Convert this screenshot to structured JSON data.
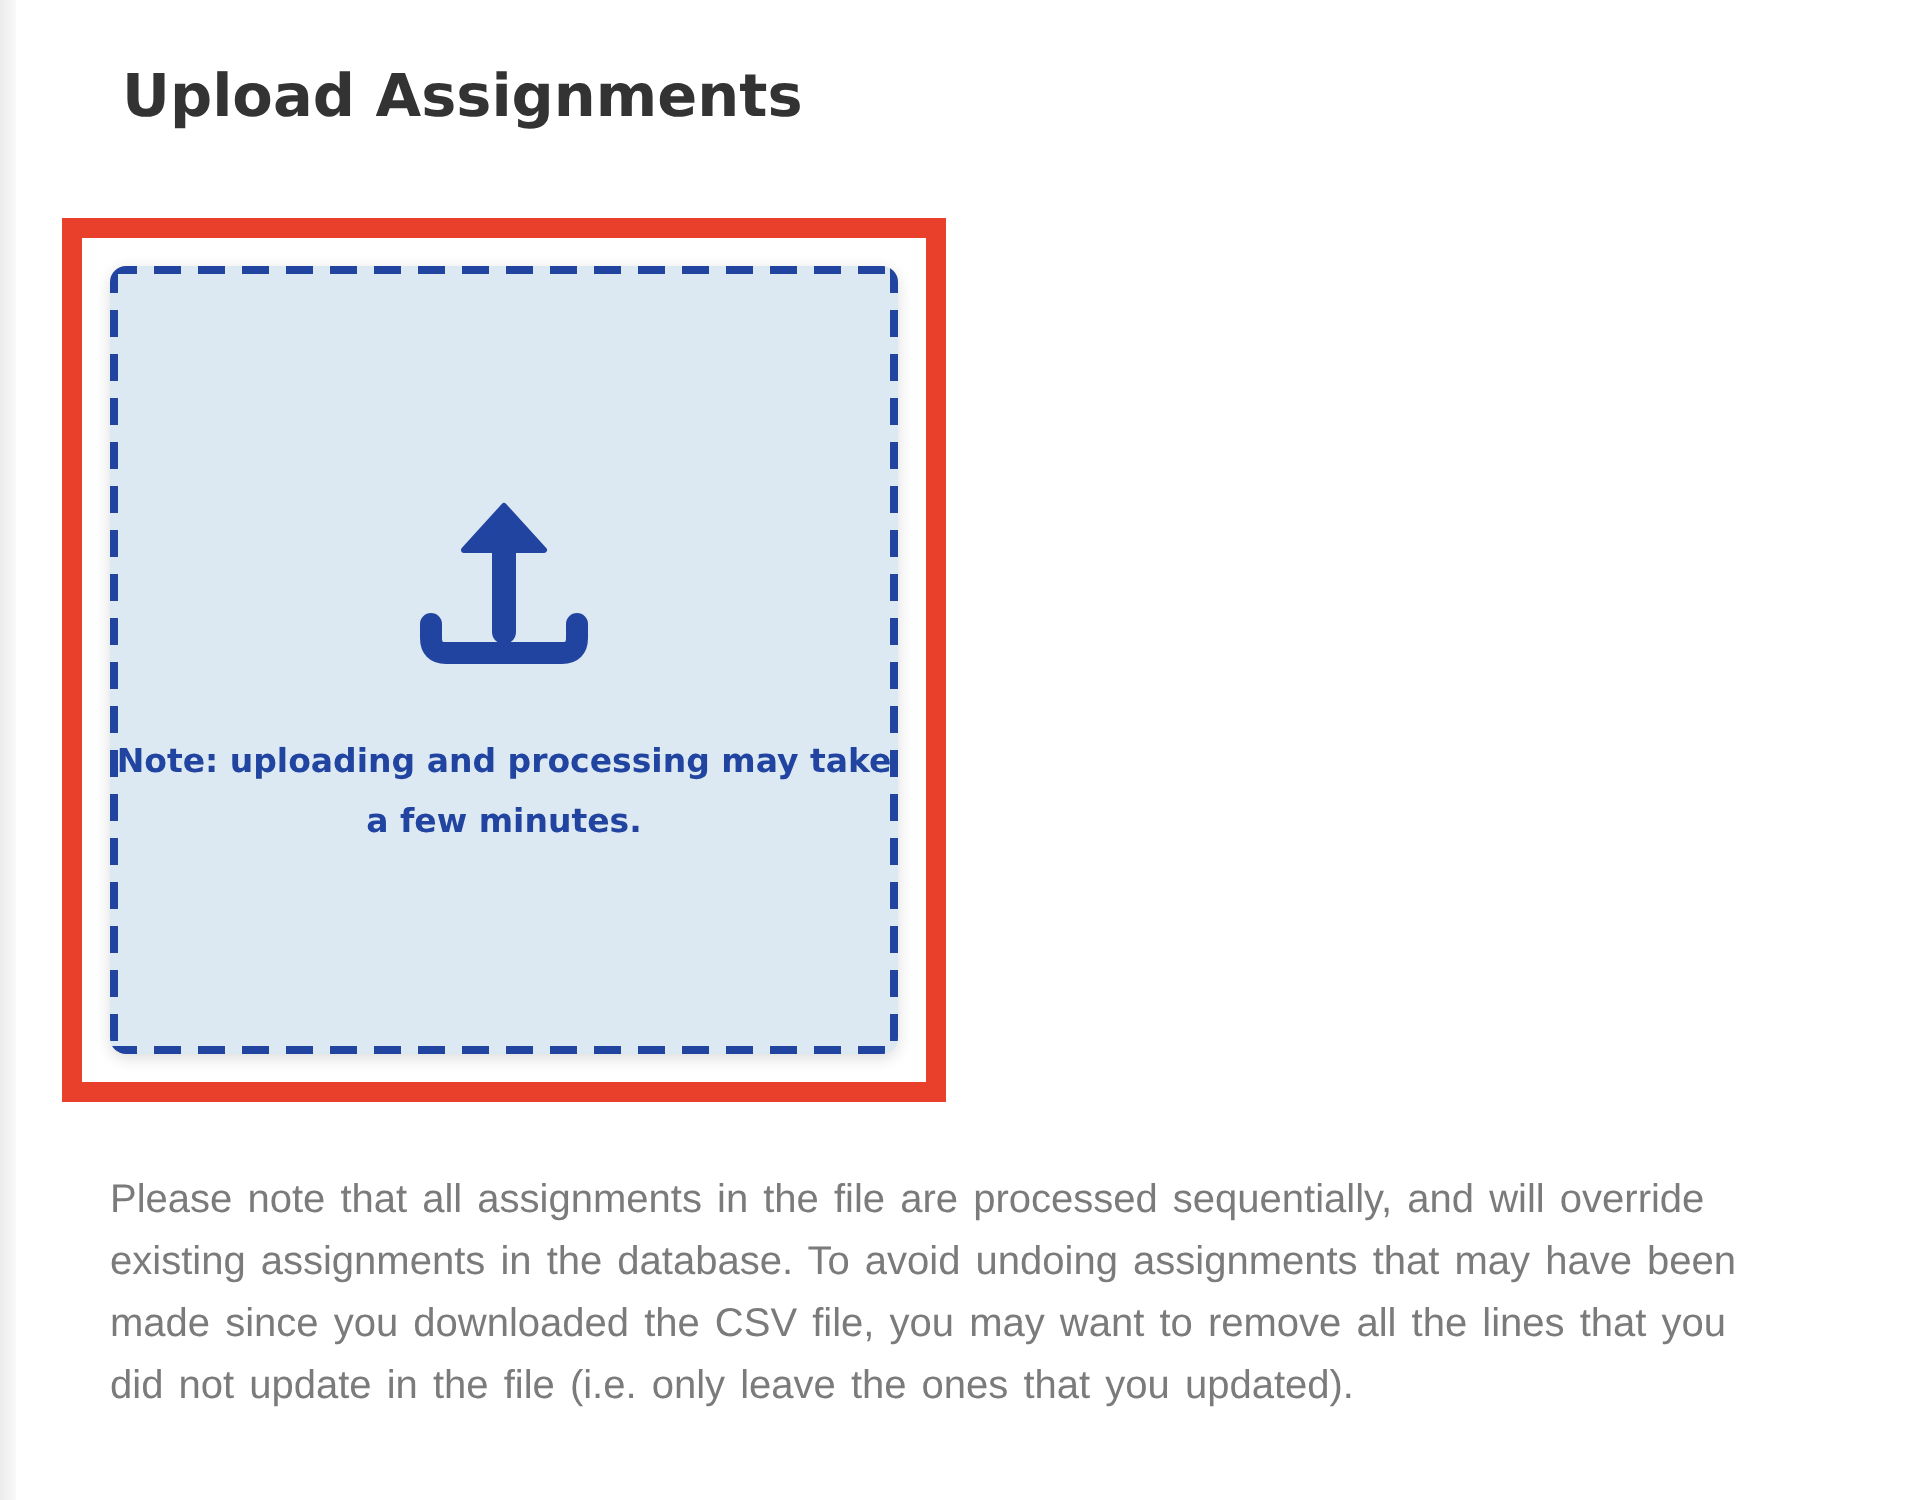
{
  "page": {
    "title": "Upload Assignments"
  },
  "dropzone": {
    "highlighted": true,
    "note": "Note: uploading and processing may take a few minutes."
  },
  "info_text": "Please note that all assignments in the file are processed sequentially, and will override existing assignments in the database. To avoid undoing assignments that may have been made since you downloaded the CSV file, you may want to remove all the lines that you did not update in the file (i.e. only leave the ones that you updated)."
}
